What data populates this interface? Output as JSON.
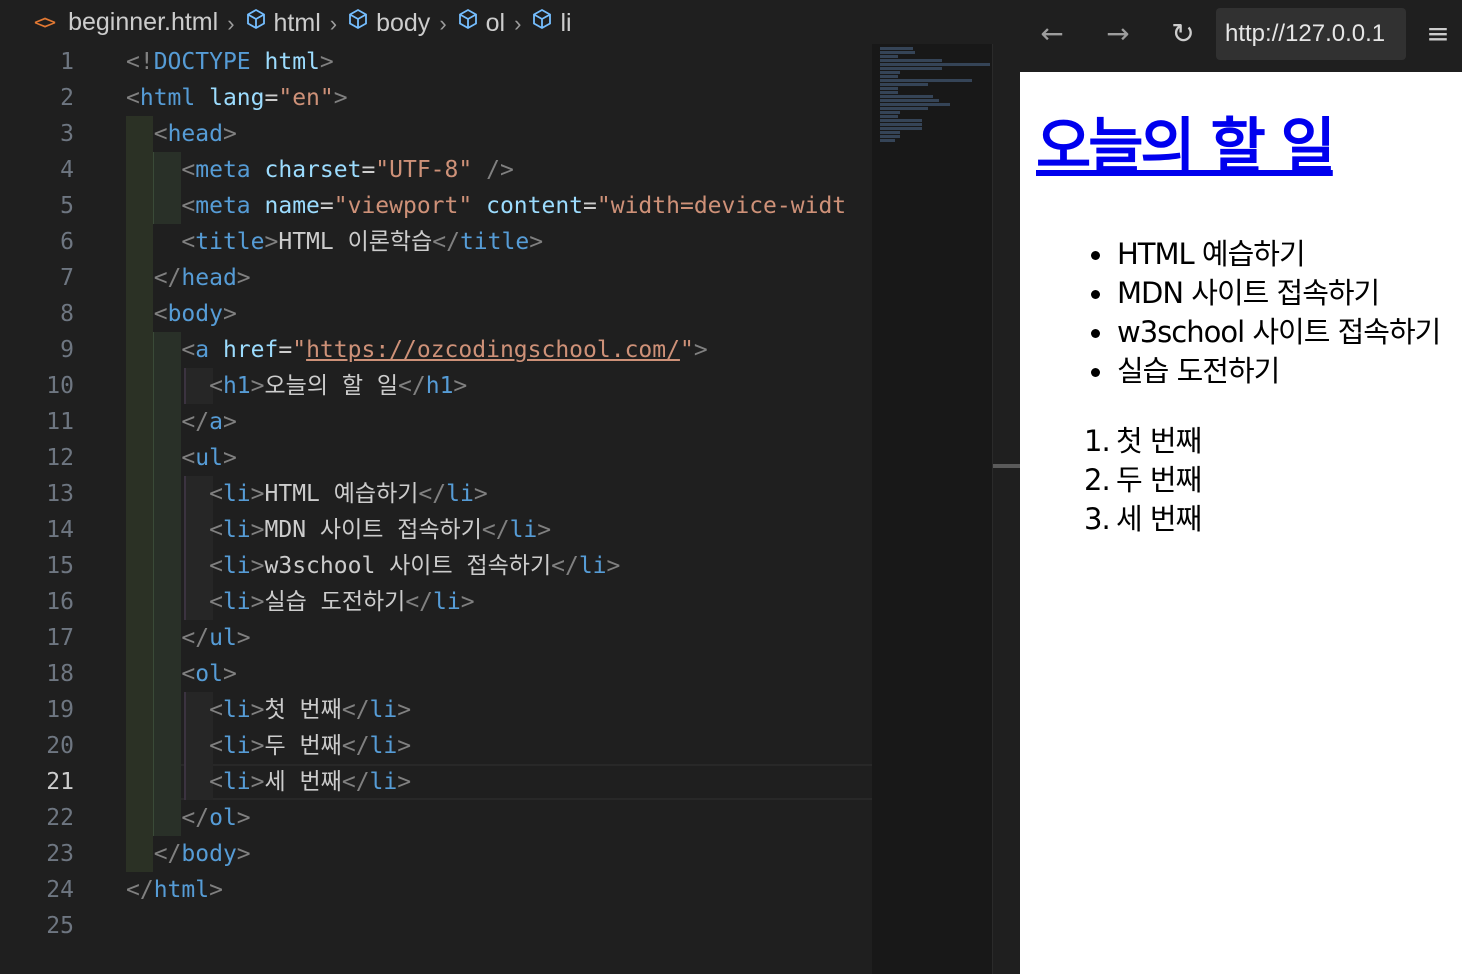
{
  "breadcrumb": {
    "file_icon": "<>",
    "file": "beginner.html",
    "items": [
      "html",
      "body",
      "ol",
      "li"
    ]
  },
  "editor": {
    "active_line": 21,
    "lines": [
      {
        "n": "1",
        "tokens": [
          [
            "t",
            "<!"
          ],
          [
            "tag",
            "DOCTYPE"
          ],
          [
            "plain",
            " "
          ],
          [
            "attr",
            "html"
          ],
          [
            "t",
            ">"
          ]
        ]
      },
      {
        "n": "2",
        "tokens": [
          [
            "t",
            "<"
          ],
          [
            "tag",
            "html"
          ],
          [
            "plain",
            " "
          ],
          [
            "attr",
            "lang"
          ],
          [
            "plain",
            "="
          ],
          [
            "str",
            "\"en\""
          ],
          [
            "t",
            ">"
          ]
        ]
      },
      {
        "n": "3",
        "tokens": [
          [
            "plain",
            "  "
          ],
          [
            "t",
            "<"
          ],
          [
            "tag",
            "head"
          ],
          [
            "t",
            ">"
          ]
        ]
      },
      {
        "n": "4",
        "tokens": [
          [
            "plain",
            "    "
          ],
          [
            "t",
            "<"
          ],
          [
            "tag",
            "meta"
          ],
          [
            "plain",
            " "
          ],
          [
            "attr",
            "charset"
          ],
          [
            "plain",
            "="
          ],
          [
            "str",
            "\"UTF-8\""
          ],
          [
            "plain",
            " "
          ],
          [
            "t",
            "/>"
          ]
        ]
      },
      {
        "n": "5",
        "tokens": [
          [
            "plain",
            "    "
          ],
          [
            "t",
            "<"
          ],
          [
            "tag",
            "meta"
          ],
          [
            "plain",
            " "
          ],
          [
            "attr",
            "name"
          ],
          [
            "plain",
            "="
          ],
          [
            "str",
            "\"viewport\""
          ],
          [
            "plain",
            " "
          ],
          [
            "attr",
            "content"
          ],
          [
            "plain",
            "="
          ],
          [
            "str",
            "\"width=device-widt"
          ]
        ]
      },
      {
        "n": "6",
        "tokens": [
          [
            "plain",
            "    "
          ],
          [
            "t",
            "<"
          ],
          [
            "tag",
            "title"
          ],
          [
            "t",
            ">"
          ],
          [
            "plain",
            "HTML 이론학습"
          ],
          [
            "t",
            "</"
          ],
          [
            "tag",
            "title"
          ],
          [
            "t",
            ">"
          ]
        ]
      },
      {
        "n": "7",
        "tokens": [
          [
            "plain",
            "  "
          ],
          [
            "t",
            "</"
          ],
          [
            "tag",
            "head"
          ],
          [
            "t",
            ">"
          ]
        ]
      },
      {
        "n": "8",
        "tokens": [
          [
            "plain",
            "  "
          ],
          [
            "t",
            "<"
          ],
          [
            "tag",
            "body"
          ],
          [
            "t",
            ">"
          ]
        ]
      },
      {
        "n": "9",
        "tokens": [
          [
            "plain",
            "    "
          ],
          [
            "t",
            "<"
          ],
          [
            "tag",
            "a"
          ],
          [
            "plain",
            " "
          ],
          [
            "attr",
            "href"
          ],
          [
            "plain",
            "="
          ],
          [
            "str",
            "\""
          ],
          [
            "url",
            "https://ozcodingschool.com/"
          ],
          [
            "str",
            "\""
          ],
          [
            "t",
            ">"
          ]
        ]
      },
      {
        "n": "10",
        "tokens": [
          [
            "plain",
            "      "
          ],
          [
            "t",
            "<"
          ],
          [
            "tag",
            "h1"
          ],
          [
            "t",
            ">"
          ],
          [
            "plain",
            "오늘의 할 일"
          ],
          [
            "t",
            "</"
          ],
          [
            "tag",
            "h1"
          ],
          [
            "t",
            ">"
          ]
        ]
      },
      {
        "n": "11",
        "tokens": [
          [
            "plain",
            "    "
          ],
          [
            "t",
            "</"
          ],
          [
            "tag",
            "a"
          ],
          [
            "t",
            ">"
          ]
        ]
      },
      {
        "n": "12",
        "tokens": [
          [
            "plain",
            "    "
          ],
          [
            "t",
            "<"
          ],
          [
            "tag",
            "ul"
          ],
          [
            "t",
            ">"
          ]
        ]
      },
      {
        "n": "13",
        "tokens": [
          [
            "plain",
            "      "
          ],
          [
            "t",
            "<"
          ],
          [
            "tag",
            "li"
          ],
          [
            "t",
            ">"
          ],
          [
            "plain",
            "HTML 예습하기"
          ],
          [
            "t",
            "</"
          ],
          [
            "tag",
            "li"
          ],
          [
            "t",
            ">"
          ]
        ]
      },
      {
        "n": "14",
        "tokens": [
          [
            "plain",
            "      "
          ],
          [
            "t",
            "<"
          ],
          [
            "tag",
            "li"
          ],
          [
            "t",
            ">"
          ],
          [
            "plain",
            "MDN 사이트 접속하기"
          ],
          [
            "t",
            "</"
          ],
          [
            "tag",
            "li"
          ],
          [
            "t",
            ">"
          ]
        ]
      },
      {
        "n": "15",
        "tokens": [
          [
            "plain",
            "      "
          ],
          [
            "t",
            "<"
          ],
          [
            "tag",
            "li"
          ],
          [
            "t",
            ">"
          ],
          [
            "plain",
            "w3school 사이트 접속하기"
          ],
          [
            "t",
            "</"
          ],
          [
            "tag",
            "li"
          ],
          [
            "t",
            ">"
          ]
        ]
      },
      {
        "n": "16",
        "tokens": [
          [
            "plain",
            "      "
          ],
          [
            "t",
            "<"
          ],
          [
            "tag",
            "li"
          ],
          [
            "t",
            ">"
          ],
          [
            "plain",
            "실습 도전하기"
          ],
          [
            "t",
            "</"
          ],
          [
            "tag",
            "li"
          ],
          [
            "t",
            ">"
          ]
        ]
      },
      {
        "n": "17",
        "tokens": [
          [
            "plain",
            "    "
          ],
          [
            "t",
            "</"
          ],
          [
            "tag",
            "ul"
          ],
          [
            "t",
            ">"
          ]
        ]
      },
      {
        "n": "18",
        "tokens": [
          [
            "plain",
            "    "
          ],
          [
            "t",
            "<"
          ],
          [
            "tag",
            "ol"
          ],
          [
            "t",
            ">"
          ]
        ]
      },
      {
        "n": "19",
        "tokens": [
          [
            "plain",
            "      "
          ],
          [
            "t",
            "<"
          ],
          [
            "tag",
            "li"
          ],
          [
            "t",
            ">"
          ],
          [
            "plain",
            "첫 번째"
          ],
          [
            "t",
            "</"
          ],
          [
            "tag",
            "li"
          ],
          [
            "t",
            ">"
          ]
        ]
      },
      {
        "n": "20",
        "tokens": [
          [
            "plain",
            "      "
          ],
          [
            "t",
            "<"
          ],
          [
            "tag",
            "li"
          ],
          [
            "t",
            ">"
          ],
          [
            "plain",
            "두 번째"
          ],
          [
            "t",
            "</"
          ],
          [
            "tag",
            "li"
          ],
          [
            "t",
            ">"
          ]
        ]
      },
      {
        "n": "21",
        "tokens": [
          [
            "plain",
            "      "
          ],
          [
            "t",
            "<"
          ],
          [
            "tag",
            "li"
          ],
          [
            "t",
            ">"
          ],
          [
            "plain",
            "세 번째"
          ],
          [
            "t",
            "</"
          ],
          [
            "tag",
            "li"
          ],
          [
            "t",
            ">"
          ]
        ]
      },
      {
        "n": "22",
        "tokens": [
          [
            "plain",
            "    "
          ],
          [
            "t",
            "</"
          ],
          [
            "tag",
            "ol"
          ],
          [
            "t",
            ">"
          ]
        ]
      },
      {
        "n": "23",
        "tokens": [
          [
            "plain",
            "  "
          ],
          [
            "t",
            "</"
          ],
          [
            "tag",
            "body"
          ],
          [
            "t",
            ">"
          ]
        ]
      },
      {
        "n": "24",
        "tokens": [
          [
            "t",
            "</"
          ],
          [
            "tag",
            "html"
          ],
          [
            "t",
            ">"
          ]
        ]
      },
      {
        "n": "25",
        "tokens": []
      }
    ]
  },
  "browser": {
    "back_icon": "←",
    "forward_icon": "→",
    "reload_icon": "↻",
    "menu_icon": "≡",
    "url": "http://127.0.0.1",
    "page": {
      "heading": "오늘의 할 일",
      "ul_items": [
        "HTML 예습하기",
        "MDN 사이트 접속하기",
        "w3school 사이트 접속하기",
        "실습 도전하기"
      ],
      "ol_items": [
        {
          "num": "1.",
          "text": "첫 번째"
        },
        {
          "num": "2.",
          "text": "두 번째"
        },
        {
          "num": "3.",
          "text": "세 번째"
        }
      ]
    }
  },
  "colors": {
    "editor_bg": "#1f1f1f",
    "tag": "#569cd6",
    "attribute": "#9cdcfe",
    "string": "#ce9178",
    "bracket": "#808080",
    "link": "#0000ee",
    "file_icon": "#e37933"
  }
}
